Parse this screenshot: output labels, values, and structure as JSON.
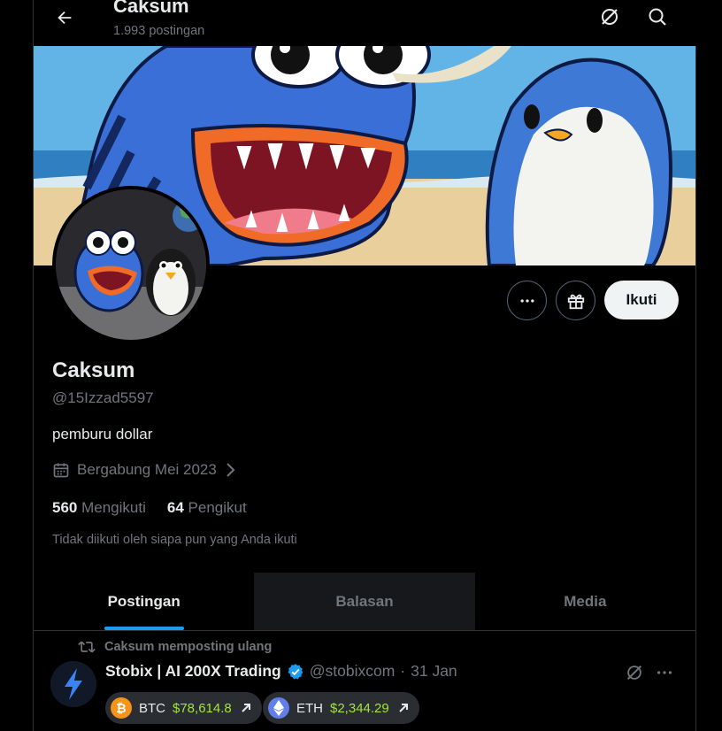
{
  "header": {
    "title": "Caksum",
    "post_count": "1.993 postingan"
  },
  "profile": {
    "name": "Caksum",
    "handle": "@15Izzad5597",
    "bio": "pemburu dollar",
    "joined": "Bergabung Mei 2023",
    "following_count": "560",
    "following_label": "Mengikuti",
    "followers_count": "64",
    "followers_label": "Pengikut",
    "not_followed_note": "Tidak diikuti oleh siapa pun yang Anda ikuti",
    "follow_label": "Ikuti"
  },
  "tabs": [
    {
      "label": "Postingan",
      "active": true
    },
    {
      "label": "Balasan",
      "active": false
    },
    {
      "label": "Media",
      "active": false
    }
  ],
  "post": {
    "repost_label": "Caksum memposting ulang",
    "author_name": "Stobix | AI 200X Trading",
    "author_handle": "@stobixcom",
    "separator": "·",
    "date": "31 Jan",
    "tickers": [
      {
        "symbol": "BTC",
        "price": "$78,614.8"
      },
      {
        "symbol": "ETH",
        "price": "$2,344.29"
      }
    ]
  },
  "colors": {
    "accent": "#1d9bf0",
    "price_green": "#a3e635",
    "muted": "#71767b"
  },
  "icons": [
    "back-arrow-icon",
    "grok-icon",
    "search-icon",
    "more-icon",
    "gift-icon",
    "calendar-icon",
    "chevron-right-icon",
    "repost-icon",
    "verified-icon",
    "bitcoin-icon",
    "ethereum-icon",
    "arrow-up-right-icon"
  ]
}
